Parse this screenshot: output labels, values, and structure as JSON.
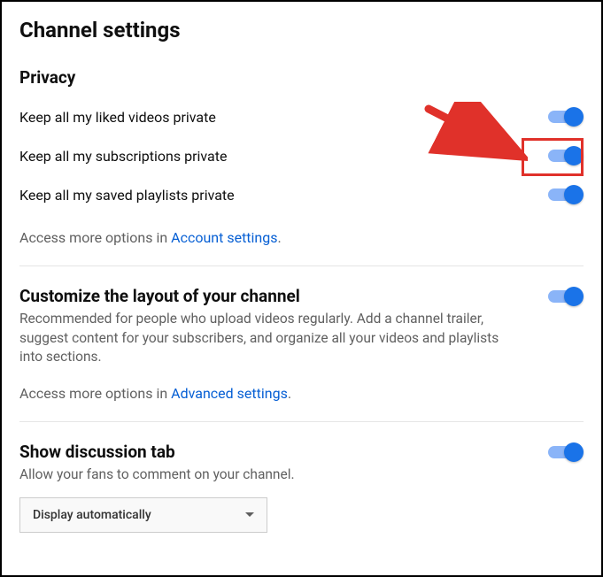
{
  "page_title": "Channel settings",
  "privacy": {
    "title": "Privacy",
    "items": [
      {
        "label": "Keep all my liked videos private"
      },
      {
        "label": "Keep all my subscriptions private"
      },
      {
        "label": "Keep all my saved playlists private"
      }
    ],
    "hint_prefix": "Access more options in ",
    "hint_link": "Account settings",
    "hint_suffix": "."
  },
  "layout": {
    "title": "Customize the layout of your channel",
    "description": "Recommended for people who upload videos regularly. Add a channel trailer, suggest content for your subscribers, and organize all your videos and playlists into sections.",
    "hint_prefix": "Access more options in ",
    "hint_link": "Advanced settings",
    "hint_suffix": "."
  },
  "discussion": {
    "title": "Show discussion tab",
    "description": "Allow your fans to comment on your channel.",
    "dropdown_value": "Display automatically"
  }
}
